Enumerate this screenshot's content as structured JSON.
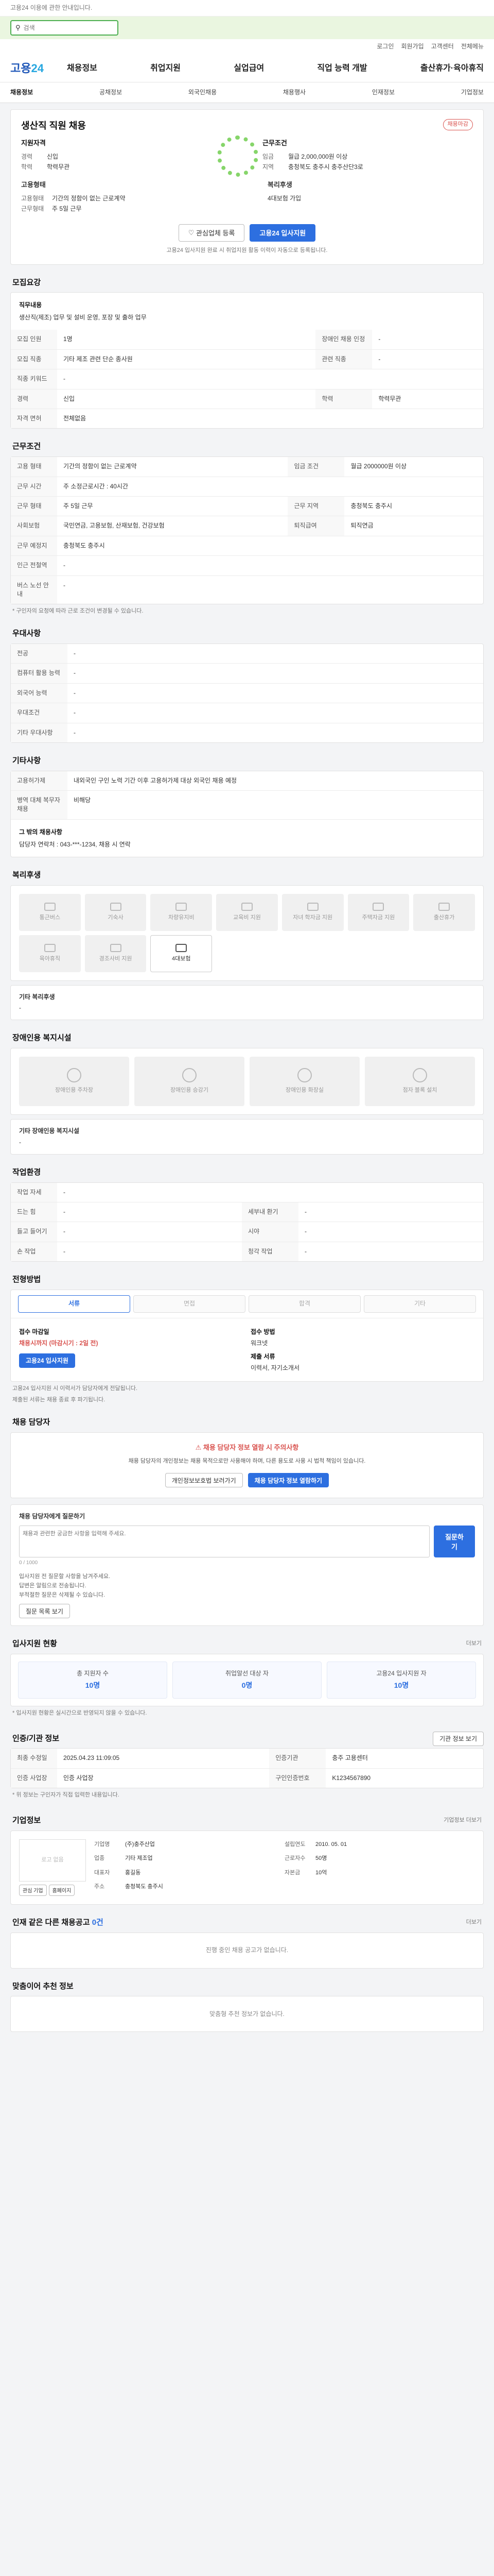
{
  "notice": {
    "text": "고용24 이용에 관한 안내입니다."
  },
  "search": {
    "placeholder": "검색"
  },
  "toplinks": [
    "로그인",
    "회원가입",
    "고객센터",
    "전체메뉴"
  ],
  "gnb": {
    "logo_a": "고용",
    "logo_b": "24",
    "menu": [
      "채용정보",
      "취업지원",
      "실업급여",
      "직업 능력 개발",
      "출산휴가·육아휴직"
    ]
  },
  "lnb": [
    "채용정보",
    "공채정보",
    "외국인채용",
    "채용행사",
    "인재정보",
    "기업정보"
  ],
  "header": {
    "company": "생산직 직원 채용",
    "badge": "채용마감",
    "left_title": "지원자격",
    "left": [
      {
        "k": "경력",
        "v": "신입"
      },
      {
        "k": "학력",
        "v": "학력무관"
      }
    ],
    "right_title": "근무조건",
    "right": [
      {
        "k": "임금",
        "v": "월급 2,000,000원 이상"
      },
      {
        "k": "지역",
        "v": "충청북도 충주시 충주산단3로"
      }
    ],
    "mid_left_title": "고용형태",
    "mid_left": [
      {
        "k": "고용형태",
        "v": "기간의 정함이 없는 근로계약"
      },
      {
        "k": "근무형태",
        "v": "주 5일 근무"
      }
    ],
    "mid_right_title": "복리후생",
    "mid_right": [
      {
        "k": "",
        "v": "4대보험 가입"
      }
    ],
    "btn_interest": "관심업체 등록",
    "btn_apply": "고용24 입사지원",
    "apply_note": "고용24 입사지원 완료 시 취업지원 활동 이력이 자동으로 등록됩니다."
  },
  "job": {
    "title": "모집요강",
    "desc_title": "직무내용",
    "desc": "생산직(제조) 업무 및 설비 운영, 포장 및 출하 업무",
    "rows": [
      [
        "모집 인원",
        "1명",
        "장애인 채용 인정",
        "-"
      ],
      [
        "모집 직종",
        "기타 제조 관련 단순 종사원",
        "관련 직종",
        "-"
      ],
      [
        "직종 키워드",
        "-",
        "",
        ""
      ],
      [
        "경력",
        "신입",
        "학력",
        "학력무관"
      ],
      [
        "자격 면허",
        "전체없음",
        "",
        ""
      ]
    ]
  },
  "cond": {
    "title": "근무조건",
    "rows": [
      [
        "고용 형태",
        "기간의 정함이 없는 근로계약",
        "임금 조건",
        "월급 2000000원 이상"
      ],
      [
        "근무 시간",
        "주 소정근로시간 : 40시간",
        "",
        ""
      ],
      [
        "근무 형태",
        "주 5일 근무",
        "근무 지역",
        "충청북도 충주시"
      ],
      [
        "사회보험",
        "국민연금, 고용보험, 산재보험, 건강보험",
        "퇴직급여",
        "퇴직연금"
      ],
      [
        "근무 예정지",
        "충청북도 충주시",
        "",
        ""
      ],
      [
        "인근 전철역",
        "-",
        "",
        ""
      ],
      [
        "버스 노선 안내",
        "-",
        "",
        ""
      ]
    ],
    "note": "* 구인자의 요청에 따라 근로 조건이 변경될 수 있습니다."
  },
  "pref": {
    "title": "우대사항",
    "rows": [
      [
        "전공",
        "-"
      ],
      [
        "컴퓨터 활용 능력",
        "-"
      ],
      [
        "외국어 능력",
        "-"
      ],
      [
        "우대조건",
        "-"
      ],
      [
        "기타 우대사항",
        "-"
      ]
    ]
  },
  "other": {
    "title": "기타사항",
    "rows": [
      [
        "고용허가제",
        "내외국인 구인 노력 기간 이후 고용허가제 대상 외국인 채용 예정"
      ],
      [
        "병역 대체 복무자 채용",
        "비해당"
      ]
    ],
    "extra_title": "그 밖의 채용사항",
    "extra": "담당자 연락처 : 043-***-1234, 채용 시 연락"
  },
  "welfare": {
    "title": "복리후생",
    "items": [
      "통근버스",
      "기숙사",
      "차량유지비",
      "교육비 지원",
      "자녀 학자금 지원",
      "주택자금 지원",
      "출산휴가",
      "육아휴직",
      "경조사비 지원",
      "4대보험"
    ],
    "active_index": 9,
    "extra_title": "기타 복리후생",
    "extra": "-"
  },
  "disability": {
    "title": "장애인용 복지시설",
    "items": [
      "장애인용 주차장",
      "장애인용 승강기",
      "장애인용 화장실",
      "점자 블록 설치"
    ],
    "extra_title": "기타 장애인용 복지시설",
    "extra": "-"
  },
  "env": {
    "title": "작업환경",
    "rows": [
      [
        "작업 자세",
        "-",
        "",
        ""
      ],
      [
        "드는 힘",
        "-",
        "세부내 환기",
        "-"
      ],
      [
        "들고 들어기",
        "-",
        "시야",
        "-"
      ],
      [
        "손 작업",
        "-",
        "청각 작업",
        "-"
      ]
    ]
  },
  "proc": {
    "title": "전형방법",
    "steps": [
      "서류",
      "면접",
      "합격",
      "기타"
    ],
    "left_h": "접수 마감일",
    "left_v": "채용시까지 (마감시기 : 2일 전)",
    "apply": "고용24 입사지원",
    "right_h": "접수 방법",
    "right_v": "워크넷",
    "right_h2": "제출 서류",
    "right_v2": "이력서, 자기소개서",
    "notes": [
      "고용24 입사지원 시 이력서가 담당자에게 전달됩니다.",
      "제출된 서류는 채용 종료 후 파기됩니다."
    ]
  },
  "manager": {
    "title": "채용 담당자",
    "red": "채용 담당자 정보 열람 시 주의사항",
    "text": "채용 담당자의 개인정보는 채용 목적으로만 사용해야 하며, 다른 용도로 사용 시 법적 책임이 있습니다.",
    "btn1": "개인정보보호법 보러가기",
    "btn2": "채용 담당자 정보 열람하기"
  },
  "inquiry": {
    "title": "채용 담당자에게 질문하기",
    "placeholder": "채용과 관련한 궁금한 사항을 입력해 주세요.",
    "counter": "0 / 1000",
    "btn": "질문하기",
    "list": [
      "입사지원 전 질문할 사항을 남겨주세요.",
      "답변은 알림으로 전송됩니다.",
      "부적절한 질문은 삭제될 수 있습니다."
    ],
    "link": "질문 목록 보기"
  },
  "stats": {
    "title": "입사지원 현황",
    "link": "더보기",
    "items": [
      [
        "총 지원자 수",
        "10명"
      ],
      [
        "취업알선 대상 자",
        "0명"
      ],
      [
        "고용24 입사지원 자",
        "10명"
      ]
    ],
    "note": "* 입사지원 현황은 실시간으로 반영되지 않을 수 있습니다."
  },
  "info": {
    "title": "인증/기관 정보",
    "btn": "기관 정보 보기",
    "rows": [
      [
        "최종 수정일",
        "2025.04.23 11:09:05",
        "인증기관",
        "충주 고용센터"
      ],
      [
        "인증 사업장",
        "인증 사업장",
        "구인인증번호",
        "K1234567890"
      ]
    ],
    "note": "* 위 정보는 구인자가 직접 입력한 내용입니다."
  },
  "companyinfo": {
    "title": "기업정보",
    "link": "기업정보 더보기",
    "logo": "로고 없음",
    "rows": [
      [
        "기업명",
        "(주)충주산업",
        "설립연도",
        "2010. 05. 01"
      ],
      [
        "업종",
        "기타 제조업",
        "근로자수",
        "50명"
      ],
      [
        "대표자",
        "홍길동",
        "자본금",
        "10억"
      ],
      [
        "주소",
        "충청북도 충주시",
        "",
        ""
      ]
    ],
    "btn1": "관심 기업",
    "btn2": "홈페이지"
  },
  "more": {
    "title": "인재 같은 다른 채용공고",
    "count": "0건",
    "empty": "진행 중인 채용 공고가 없습니다.",
    "link": "더보기"
  },
  "recommend": {
    "title": "맞춤이어 추천 정보",
    "empty": "맞춤형 추천 정보가 없습니다."
  }
}
